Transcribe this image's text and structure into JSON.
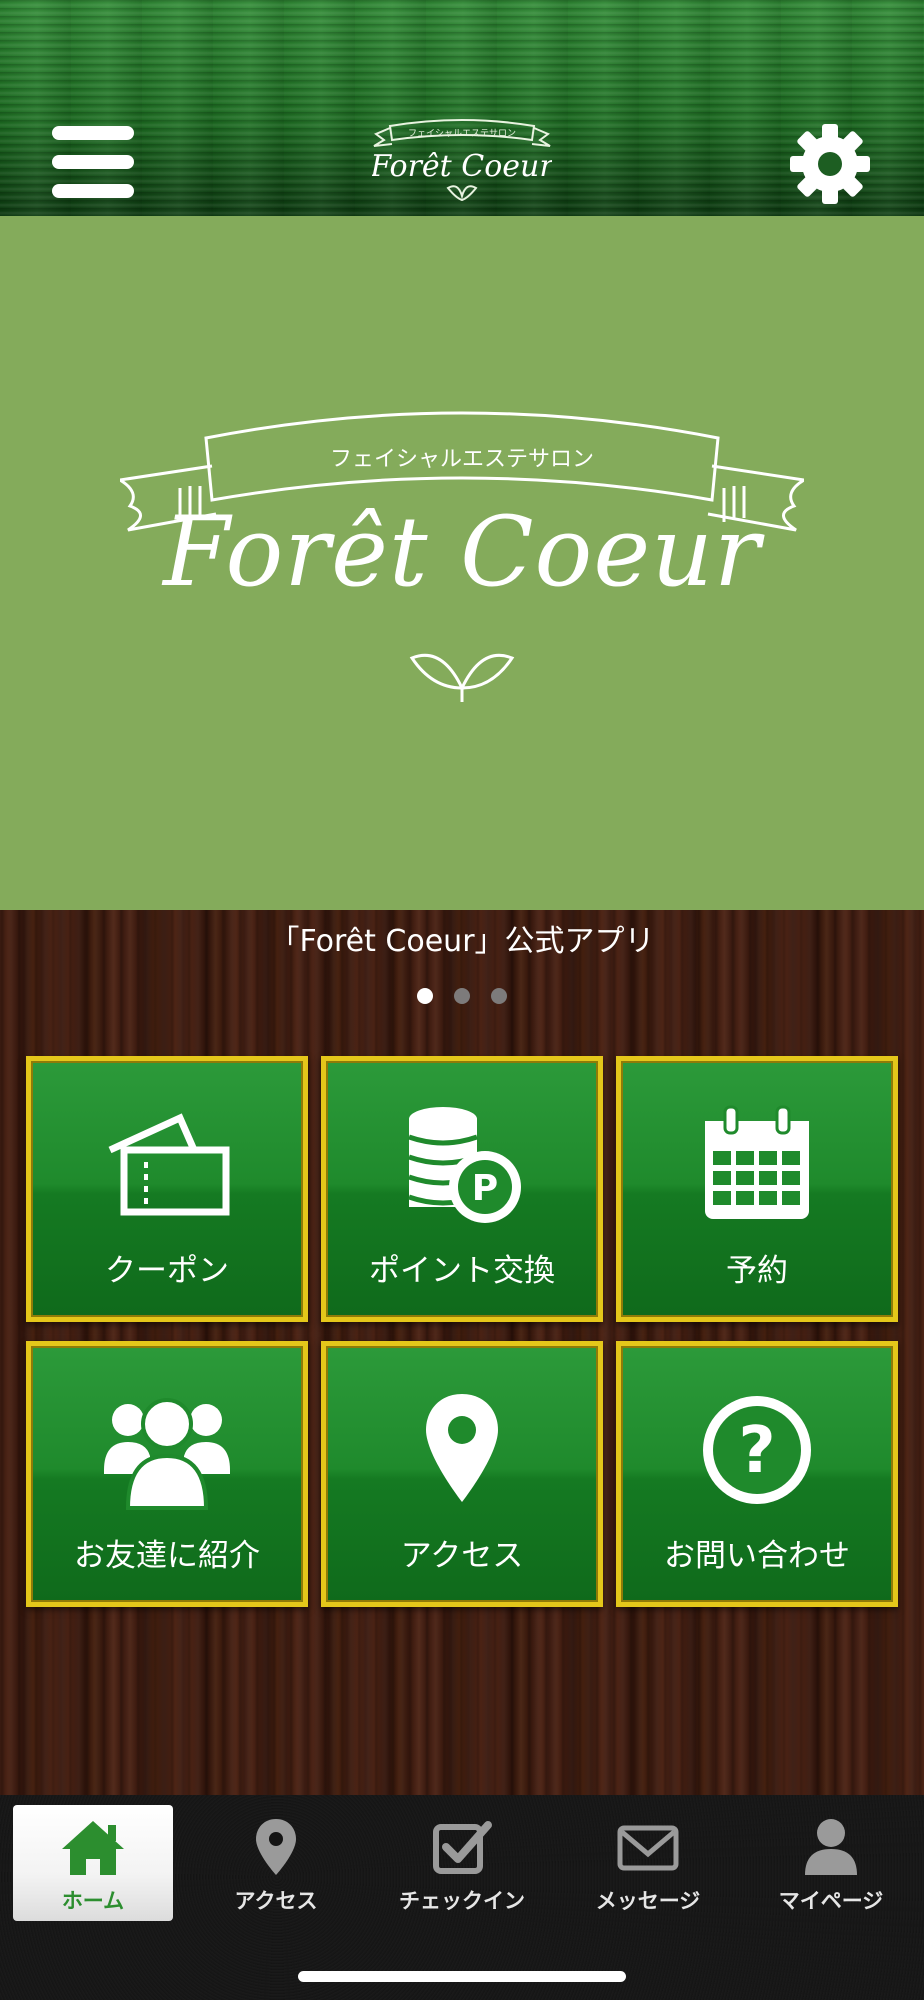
{
  "colors": {
    "header_green": "#1d6f22",
    "banner_green": "#84ab5b",
    "tile_green": "#1f8a2c",
    "tile_border_gold": "#e4c71a",
    "nav_active_green": "#2c8e2f",
    "wood_brown": "#3a1a10"
  },
  "header": {
    "menu_icon": "hamburger-icon",
    "logo_subtitle": "フェイシャルエステサロン",
    "logo_title": "Forêt Coeur",
    "settings_icon": "gear-icon"
  },
  "banner": {
    "ribbon_text": "フェイシャルエステサロン",
    "brand_name": "Forêt Coeur",
    "leaf_icon": "leaf-icon"
  },
  "main": {
    "caption": "「Forêt Coeur」公式アプリ",
    "carousel": {
      "page_count": 3,
      "active_index": 0
    },
    "tiles": [
      {
        "label": "クーポン",
        "icon": "ticket-icon"
      },
      {
        "label": "ポイント交換",
        "icon": "coins-icon"
      },
      {
        "label": "予約",
        "icon": "calendar-icon"
      },
      {
        "label": "お友達に紹介",
        "icon": "group-icon"
      },
      {
        "label": "アクセス",
        "icon": "location-pin-icon"
      },
      {
        "label": "お問い合わせ",
        "icon": "question-icon"
      }
    ]
  },
  "bottom_nav": {
    "items": [
      {
        "label": "ホーム",
        "icon": "home-icon",
        "active": true
      },
      {
        "label": "アクセス",
        "icon": "location-pin-icon",
        "active": false
      },
      {
        "label": "チェックイン",
        "icon": "checkbox-icon",
        "active": false
      },
      {
        "label": "メッセージ",
        "icon": "envelope-icon",
        "active": false
      },
      {
        "label": "マイページ",
        "icon": "user-icon",
        "active": false
      }
    ]
  }
}
